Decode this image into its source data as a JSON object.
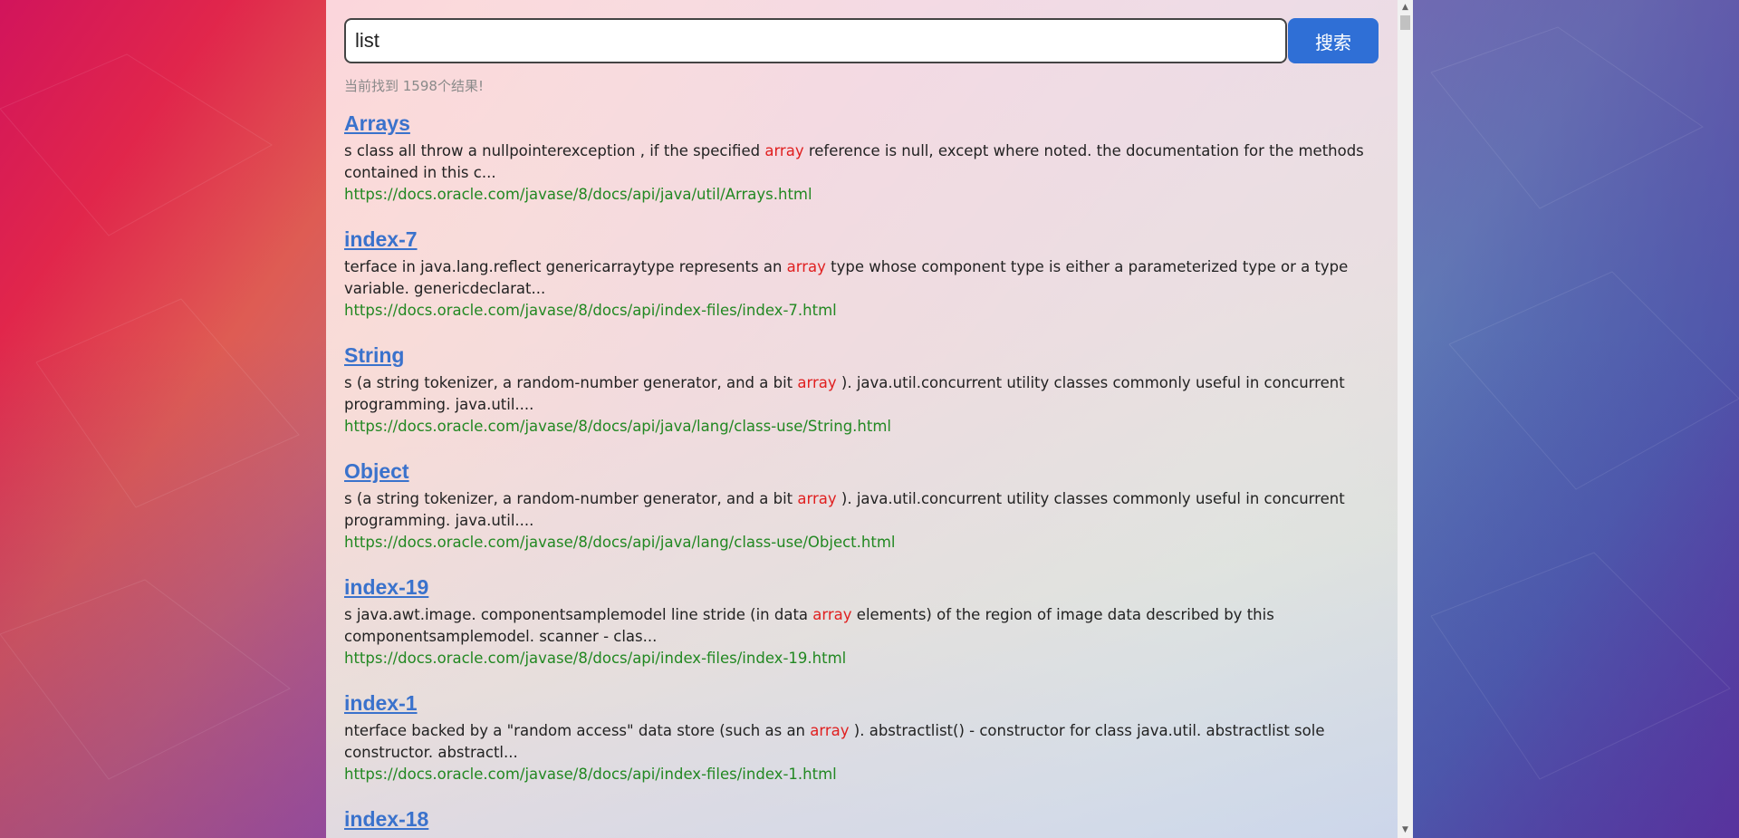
{
  "search": {
    "query": "list",
    "button_label": "搜索",
    "result_count_text": "当前找到 1598个结果!"
  },
  "results": [
    {
      "title": "Arrays",
      "desc_before": "s class all throw a nullpointerexception , if the specified ",
      "keyword": "array",
      "desc_after": " reference is null, except where noted. the documentation for the methods contained in this c...",
      "url": "https://docs.oracle.com/javase/8/docs/api/java/util/Arrays.html"
    },
    {
      "title": "index-7",
      "desc_before": "terface in java.lang.reflect genericarraytype represents an ",
      "keyword": "array",
      "desc_after": " type whose component type is either a parameterized type or a type variable. genericdeclarat...",
      "url": "https://docs.oracle.com/javase/8/docs/api/index-files/index-7.html"
    },
    {
      "title": "String",
      "desc_before": "s (a string tokenizer, a random-number generator, and a bit ",
      "keyword": "array",
      "desc_after": " ). java.util.concurrent utility classes commonly useful in concurrent programming. java.util....",
      "url": "https://docs.oracle.com/javase/8/docs/api/java/lang/class-use/String.html"
    },
    {
      "title": "Object",
      "desc_before": "s (a string tokenizer, a random-number generator, and a bit ",
      "keyword": "array",
      "desc_after": " ). java.util.concurrent utility classes commonly useful in concurrent programming. java.util....",
      "url": "https://docs.oracle.com/javase/8/docs/api/java/lang/class-use/Object.html"
    },
    {
      "title": "index-19",
      "desc_before": "s java.awt.image. componentsamplemodel line stride (in data ",
      "keyword": "array",
      "desc_after": " elements) of the region of image data described by this componentsamplemodel. scanner - clas...",
      "url": "https://docs.oracle.com/javase/8/docs/api/index-files/index-19.html"
    },
    {
      "title": "index-1",
      "desc_before": "nterface backed by a \"random access\" data store (such as an ",
      "keyword": "array",
      "desc_after": " ). abstractlist() - constructor for class java.util. abstractlist sole constructor. abstractl...",
      "url": "https://docs.oracle.com/javase/8/docs/api/index-files/index-1.html"
    },
    {
      "title": "index-18",
      "desc_before": "",
      "keyword": "",
      "desc_after": "",
      "url": ""
    }
  ],
  "scrollbar": {
    "up_glyph": "▲",
    "down_glyph": "▼"
  }
}
